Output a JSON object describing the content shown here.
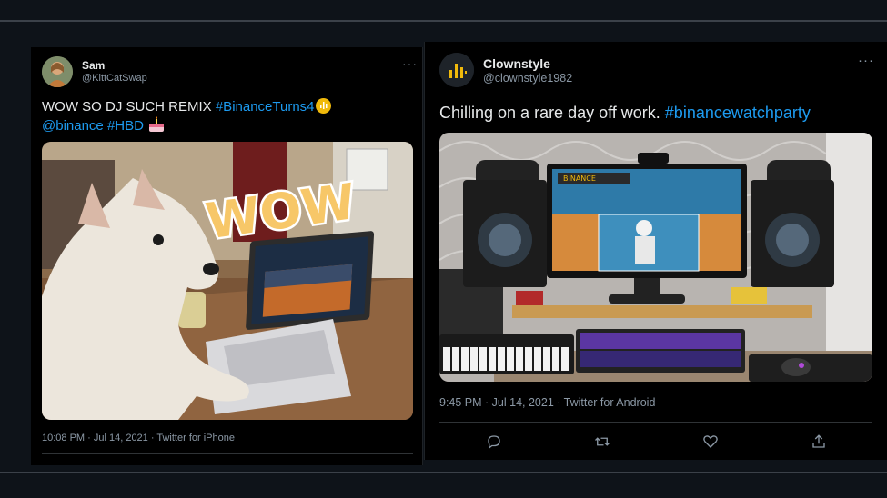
{
  "tweets": [
    {
      "name": "Sam",
      "handle": "@KittCatSwap",
      "text_plain": "WOW SO DJ SUCH REMIX ",
      "hashtag1": "#BinanceTurns4",
      "mention": "@binance",
      "hashtag2": "#HBD",
      "image_overlay": "WOW",
      "timestamp": "10:08 PM · Jul 14, 2021 · Twitter for iPhone"
    },
    {
      "name": "Clownstyle",
      "handle": "@clownstyle1982",
      "text_plain": "Chilling on a rare day off work. ",
      "hashtag1": "#binancewatchparty",
      "image_brand": "BINANCE",
      "timestamp": "9:45 PM · Jul 14, 2021 · Twitter for Android"
    }
  ],
  "icons": {
    "more": "more-icon",
    "reply": "reply-icon",
    "retweet": "retweet-icon",
    "like": "like-icon",
    "share": "share-icon",
    "emoji_binance": "binance-logo-emoji",
    "emoji_cake": "cake-emoji"
  },
  "colors": {
    "background": "#0e1319",
    "card": "#000000",
    "link": "#1d9bf0",
    "secondary_text": "#8b98a5",
    "binance_yellow": "#f0b90b"
  }
}
